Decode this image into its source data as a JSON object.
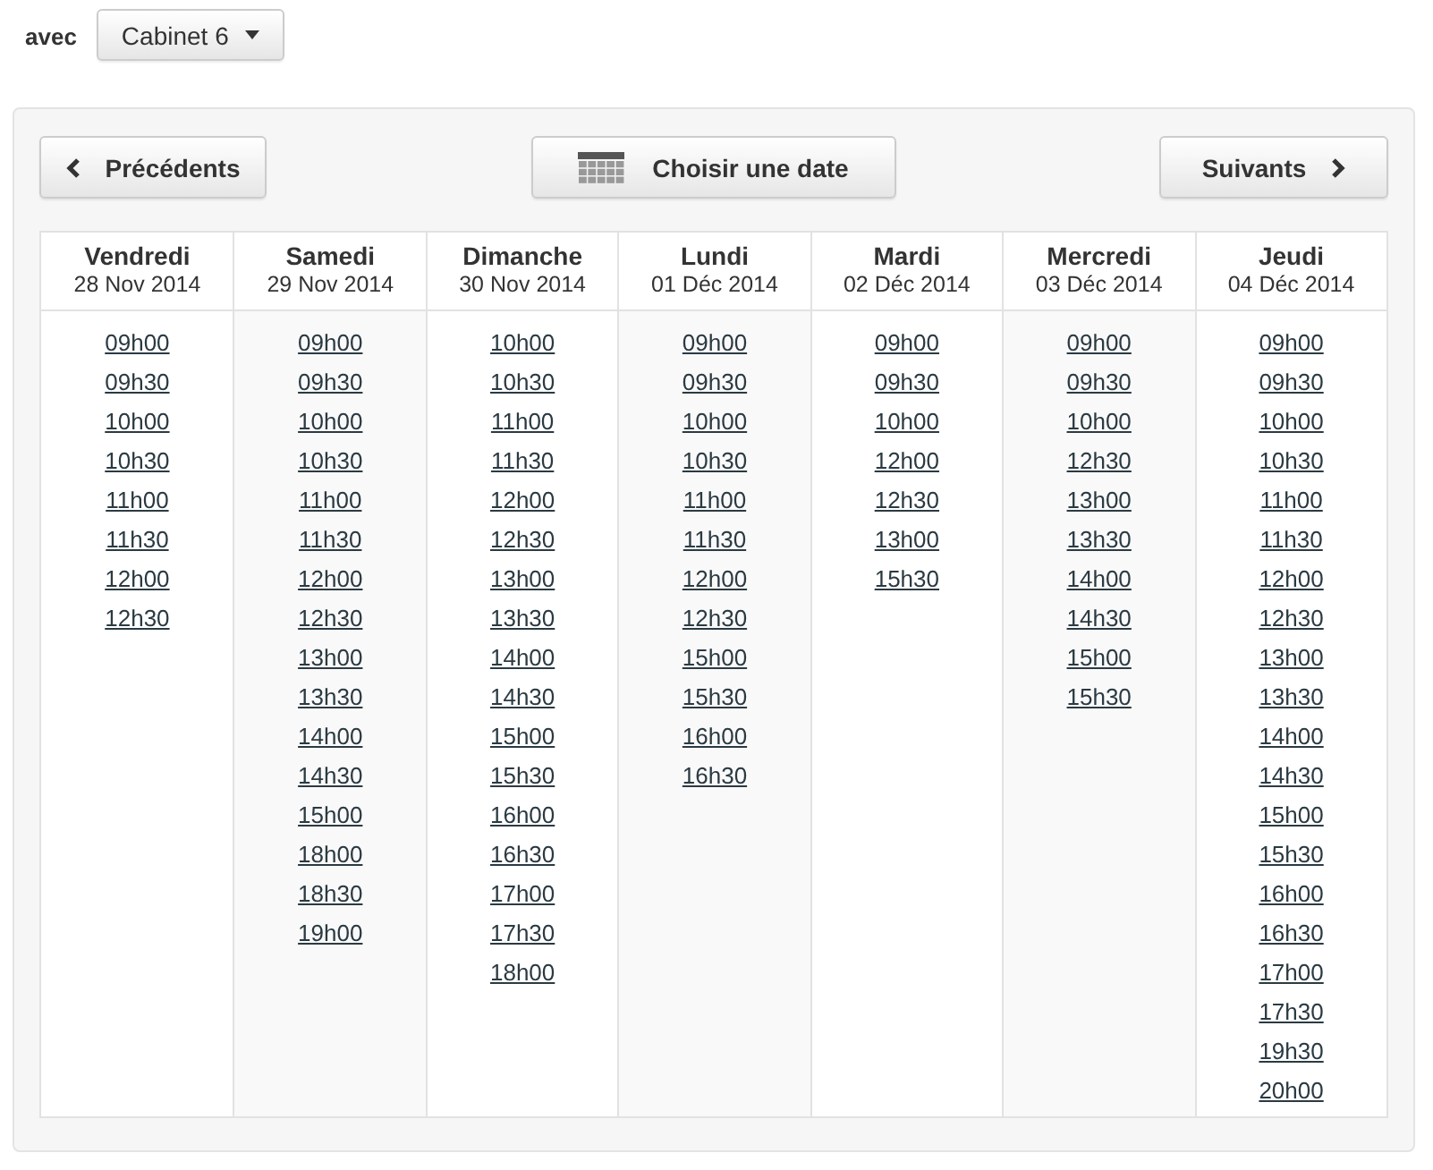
{
  "practitioner": {
    "label": "avec",
    "value": "Cabinet 6"
  },
  "navigation": {
    "previous": "Précédents",
    "pick_date": "Choisir une date",
    "next": "Suivants"
  },
  "days": [
    {
      "name": "Vendredi",
      "date": "28 Nov 2014",
      "slots": [
        "09h00",
        "09h30",
        "10h00",
        "10h30",
        "11h00",
        "11h30",
        "12h00",
        "12h30"
      ]
    },
    {
      "name": "Samedi",
      "date": "29 Nov 2014",
      "slots": [
        "09h00",
        "09h30",
        "10h00",
        "10h30",
        "11h00",
        "11h30",
        "12h00",
        "12h30",
        "13h00",
        "13h30",
        "14h00",
        "14h30",
        "15h00",
        "18h00",
        "18h30",
        "19h00"
      ]
    },
    {
      "name": "Dimanche",
      "date": "30 Nov 2014",
      "slots": [
        "10h00",
        "10h30",
        "11h00",
        "11h30",
        "12h00",
        "12h30",
        "13h00",
        "13h30",
        "14h00",
        "14h30",
        "15h00",
        "15h30",
        "16h00",
        "16h30",
        "17h00",
        "17h30",
        "18h00"
      ]
    },
    {
      "name": "Lundi",
      "date": "01 Déc 2014",
      "slots": [
        "09h00",
        "09h30",
        "10h00",
        "10h30",
        "11h00",
        "11h30",
        "12h00",
        "12h30",
        "15h00",
        "15h30",
        "16h00",
        "16h30"
      ]
    },
    {
      "name": "Mardi",
      "date": "02 Déc 2014",
      "slots": [
        "09h00",
        "09h30",
        "10h00",
        "12h00",
        "12h30",
        "13h00",
        "15h30"
      ]
    },
    {
      "name": "Mercredi",
      "date": "03 Déc 2014",
      "slots": [
        "09h00",
        "09h30",
        "10h00",
        "12h30",
        "13h00",
        "13h30",
        "14h00",
        "14h30",
        "15h00",
        "15h30"
      ]
    },
    {
      "name": "Jeudi",
      "date": "04 Déc 2014",
      "slots": [
        "09h00",
        "09h30",
        "10h00",
        "10h30",
        "11h00",
        "11h30",
        "12h00",
        "12h30",
        "13h00",
        "13h30",
        "14h00",
        "14h30",
        "15h00",
        "15h30",
        "16h00",
        "16h30",
        "17h00",
        "17h30",
        "19h30",
        "20h00"
      ]
    }
  ]
}
